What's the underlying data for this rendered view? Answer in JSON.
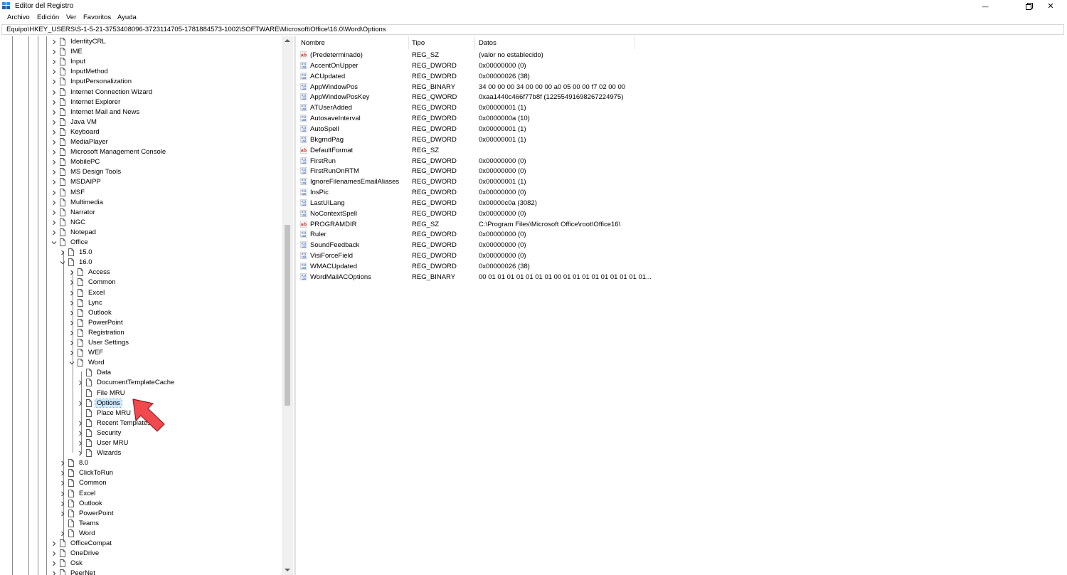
{
  "window": {
    "title": "Editor del Registro",
    "minimize_glyph": "—",
    "close_glyph": "✕"
  },
  "menu": [
    "Archivo",
    "Edición",
    "Ver",
    "Favoritos",
    "Ayuda"
  ],
  "address": "Equipo\\HKEY_USERS\\S-1-5-21-3753408096-3723114705-1781884573-1002\\SOFTWARE\\Microsoft\\Office\\16.0\\Word\\Options",
  "tree": [
    {
      "label": "IdentityCRL",
      "depth": 0,
      "chevron": "right"
    },
    {
      "label": "IME",
      "depth": 0,
      "chevron": "right"
    },
    {
      "label": "Input",
      "depth": 0,
      "chevron": "right"
    },
    {
      "label": "InputMethod",
      "depth": 0,
      "chevron": "right"
    },
    {
      "label": "InputPersonalization",
      "depth": 0,
      "chevron": "right"
    },
    {
      "label": "Internet Connection Wizard",
      "depth": 0,
      "chevron": "right"
    },
    {
      "label": "Internet Explorer",
      "depth": 0,
      "chevron": "right"
    },
    {
      "label": "Internet Mail and News",
      "depth": 0,
      "chevron": "right"
    },
    {
      "label": "Java VM",
      "depth": 0,
      "chevron": "right"
    },
    {
      "label": "Keyboard",
      "depth": 0,
      "chevron": "right"
    },
    {
      "label": "MediaPlayer",
      "depth": 0,
      "chevron": "right"
    },
    {
      "label": "Microsoft Management Console",
      "depth": 0,
      "chevron": "right"
    },
    {
      "label": "MobilePC",
      "depth": 0,
      "chevron": "right"
    },
    {
      "label": "MS Design Tools",
      "depth": 0,
      "chevron": "right"
    },
    {
      "label": "MSDAIPP",
      "depth": 0,
      "chevron": "right"
    },
    {
      "label": "MSF",
      "depth": 0,
      "chevron": "right"
    },
    {
      "label": "Multimedia",
      "depth": 0,
      "chevron": "right"
    },
    {
      "label": "Narrator",
      "depth": 0,
      "chevron": "right"
    },
    {
      "label": "NGC",
      "depth": 0,
      "chevron": "right"
    },
    {
      "label": "Notepad",
      "depth": 0,
      "chevron": "right"
    },
    {
      "label": "Office",
      "depth": 0,
      "chevron": "down"
    },
    {
      "label": "15.0",
      "depth": 1,
      "chevron": "right"
    },
    {
      "label": "16.0",
      "depth": 1,
      "chevron": "down"
    },
    {
      "label": "Access",
      "depth": 2,
      "chevron": "right"
    },
    {
      "label": "Common",
      "depth": 2,
      "chevron": "right"
    },
    {
      "label": "Excel",
      "depth": 2,
      "chevron": "right"
    },
    {
      "label": "Lync",
      "depth": 2,
      "chevron": "right"
    },
    {
      "label": "Outlook",
      "depth": 2,
      "chevron": "right"
    },
    {
      "label": "PowerPoint",
      "depth": 2,
      "chevron": "right"
    },
    {
      "label": "Registration",
      "depth": 2,
      "chevron": "right"
    },
    {
      "label": "User Settings",
      "depth": 2,
      "chevron": "right"
    },
    {
      "label": "WEF",
      "depth": 2,
      "chevron": "right"
    },
    {
      "label": "Word",
      "depth": 2,
      "chevron": "down"
    },
    {
      "label": "Data",
      "depth": 3,
      "chevron": "none"
    },
    {
      "label": "DocumentTemplateCache",
      "depth": 3,
      "chevron": "right"
    },
    {
      "label": "File MRU",
      "depth": 3,
      "chevron": "none"
    },
    {
      "label": "Options",
      "depth": 3,
      "chevron": "right",
      "selected": true
    },
    {
      "label": "Place MRU",
      "depth": 3,
      "chevron": "none"
    },
    {
      "label": "Recent Templates",
      "depth": 3,
      "chevron": "right"
    },
    {
      "label": "Security",
      "depth": 3,
      "chevron": "right"
    },
    {
      "label": "User MRU",
      "depth": 3,
      "chevron": "right"
    },
    {
      "label": "Wizards",
      "depth": 3,
      "chevron": "right"
    },
    {
      "label": "8.0",
      "depth": 1,
      "chevron": "right"
    },
    {
      "label": "ClickToRun",
      "depth": 1,
      "chevron": "right"
    },
    {
      "label": "Common",
      "depth": 1,
      "chevron": "right"
    },
    {
      "label": "Excel",
      "depth": 1,
      "chevron": "right"
    },
    {
      "label": "Outlook",
      "depth": 1,
      "chevron": "right"
    },
    {
      "label": "PowerPoint",
      "depth": 1,
      "chevron": "right"
    },
    {
      "label": "Teams",
      "depth": 1,
      "chevron": "none"
    },
    {
      "label": "Word",
      "depth": 1,
      "chevron": "right"
    },
    {
      "label": "OfficeCompat",
      "depth": 0,
      "chevron": "right"
    },
    {
      "label": "OneDrive",
      "depth": 0,
      "chevron": "right"
    },
    {
      "label": "Osk",
      "depth": 0,
      "chevron": "right"
    },
    {
      "label": "PeerNet",
      "depth": 0,
      "chevron": "right"
    }
  ],
  "columns": [
    "Nombre",
    "Tipo",
    "Datos"
  ],
  "values": [
    {
      "name": "(Predeterminado)",
      "type": "REG_SZ",
      "data": "(valor no establecido)",
      "icon": "string"
    },
    {
      "name": "AccentOnUpper",
      "type": "REG_DWORD",
      "data": "0x00000000 (0)",
      "icon": "binary"
    },
    {
      "name": "ACUpdated",
      "type": "REG_DWORD",
      "data": "0x00000026 (38)",
      "icon": "binary"
    },
    {
      "name": "AppWindowPos",
      "type": "REG_BINARY",
      "data": "34 00 00 00 34 00 00 00 a0 05 00 00 f7 02 00 00",
      "icon": "binary"
    },
    {
      "name": "AppWindowPosKey",
      "type": "REG_QWORD",
      "data": "0xaa1440c466f77b8f (12255491698267224975)",
      "icon": "binary"
    },
    {
      "name": "ATUserAdded",
      "type": "REG_DWORD",
      "data": "0x00000001 (1)",
      "icon": "binary"
    },
    {
      "name": "AutosaveInterval",
      "type": "REG_DWORD",
      "data": "0x0000000a (10)",
      "icon": "binary"
    },
    {
      "name": "AutoSpell",
      "type": "REG_DWORD",
      "data": "0x00000001 (1)",
      "icon": "binary"
    },
    {
      "name": "BkgrndPag",
      "type": "REG_DWORD",
      "data": "0x00000001 (1)",
      "icon": "binary"
    },
    {
      "name": "DefaultFormat",
      "type": "REG_SZ",
      "data": "",
      "icon": "string"
    },
    {
      "name": "FirstRun",
      "type": "REG_DWORD",
      "data": "0x00000000 (0)",
      "icon": "binary"
    },
    {
      "name": "FirstRunOnRTM",
      "type": "REG_DWORD",
      "data": "0x00000000 (0)",
      "icon": "binary"
    },
    {
      "name": "IgnoreFilenamesEmailAliases",
      "type": "REG_DWORD",
      "data": "0x00000001 (1)",
      "icon": "binary"
    },
    {
      "name": "InsPic",
      "type": "REG_DWORD",
      "data": "0x00000000 (0)",
      "icon": "binary"
    },
    {
      "name": "LastUILang",
      "type": "REG_DWORD",
      "data": "0x00000c0a (3082)",
      "icon": "binary"
    },
    {
      "name": "NoContextSpell",
      "type": "REG_DWORD",
      "data": "0x00000000 (0)",
      "icon": "binary"
    },
    {
      "name": "PROGRAMDIR",
      "type": "REG_SZ",
      "data": "C:\\Program Files\\Microsoft Office\\root\\Office16\\",
      "icon": "string"
    },
    {
      "name": "Ruler",
      "type": "REG_DWORD",
      "data": "0x00000000 (0)",
      "icon": "binary"
    },
    {
      "name": "SoundFeedback",
      "type": "REG_DWORD",
      "data": "0x00000000 (0)",
      "icon": "binary"
    },
    {
      "name": "VisiForceField",
      "type": "REG_DWORD",
      "data": "0x00000000 (0)",
      "icon": "binary"
    },
    {
      "name": "WMACUpdated",
      "type": "REG_DWORD",
      "data": "0x00000026 (38)",
      "icon": "binary"
    },
    {
      "name": "WordMailACOptions",
      "type": "REG_BINARY",
      "data": "00 01 01 01 01 01 01 01 00 01 01 01 01 01 01 01 01 01...",
      "icon": "binary"
    }
  ],
  "colors": {
    "selection": "#cce8ff",
    "arrow": "#f04a4f",
    "string_icon": "#d2332b",
    "binary_icon": "#2f62b5"
  }
}
